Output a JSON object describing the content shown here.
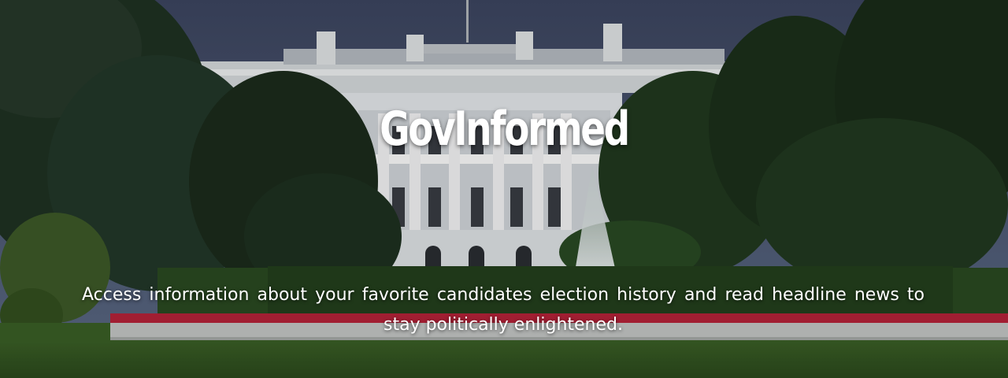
{
  "hero": {
    "title": "GovInformed",
    "tagline": "Access information about your favorite candidates election history and read headline news to stay politically enlightened.",
    "background": "white-house-photo"
  },
  "colors": {
    "text": "#ffffff",
    "sky": "#5a6a86",
    "lawn": "#3f6b2a",
    "flowers": "#c8283a",
    "building": "#e8ecef"
  }
}
